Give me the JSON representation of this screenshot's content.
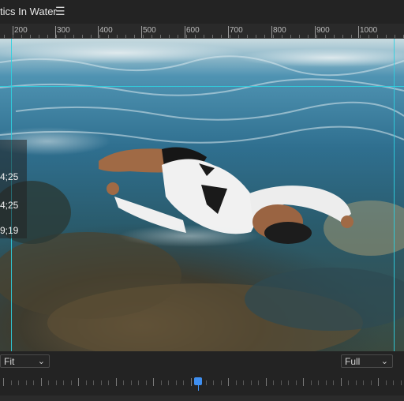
{
  "panel": {
    "title": "tics In Water",
    "menu_icon": "hamburger-menu-icon"
  },
  "ruler": {
    "labels": [
      "200",
      "300",
      "400",
      "500",
      "600",
      "700",
      "800",
      "900",
      "1000"
    ]
  },
  "overlay": {
    "timecodes": [
      "4;25",
      "4;25",
      "9;19"
    ]
  },
  "controls": {
    "zoom_fit": "Fit",
    "resolution": "Full"
  },
  "colors": {
    "guide": "#2fd0e0",
    "playhead": "#3f8ff0"
  }
}
